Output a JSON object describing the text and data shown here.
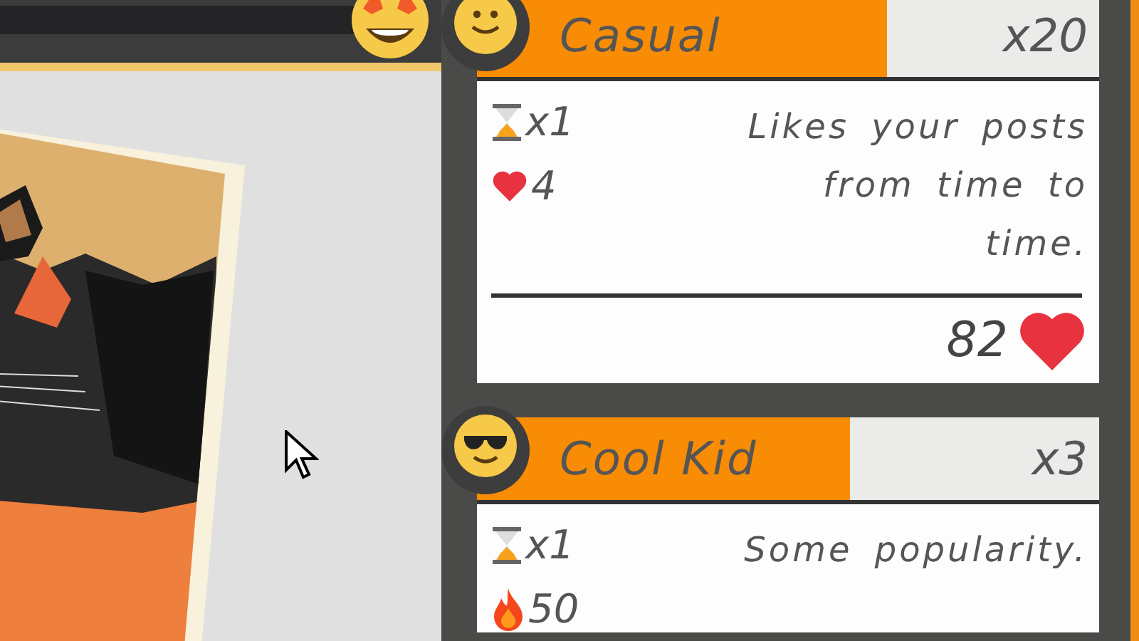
{
  "cards": [
    {
      "kind": "smile",
      "title": "Casual",
      "count": "x20",
      "level": 0.66,
      "stats": [
        {
          "kind": "time",
          "value": "x1"
        },
        {
          "kind": "likes",
          "value": "4"
        }
      ],
      "description": "Likes your posts from time to time.",
      "reward": "82"
    },
    {
      "kind": "cool",
      "title": "Cool Kid",
      "count": "x3",
      "level": 0.6,
      "stats": [
        {
          "kind": "time",
          "value": "x1"
        },
        {
          "kind": "fire",
          "value": "50"
        }
      ],
      "description": "Some popularity."
    }
  ]
}
